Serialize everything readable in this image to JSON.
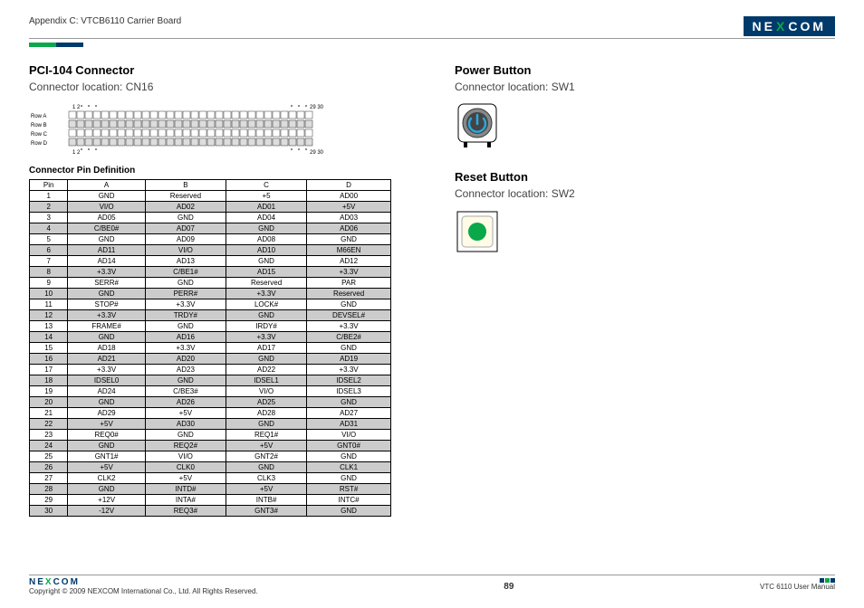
{
  "header": {
    "title": "Appendix C: VTCB6110 Carrier Board",
    "brand_parts": [
      "NE",
      "X",
      "COM"
    ]
  },
  "left": {
    "heading": "PCI-104 Connector",
    "sub": "Connector location: CN16",
    "diagram": {
      "row_labels": [
        "Row A",
        "Row B",
        "Row C",
        "Row D"
      ],
      "top_start": "1  2",
      "top_end": "29 30",
      "bot_start": "1  2",
      "bot_end": "29 30"
    },
    "table_caption": "Connector Pin Definition",
    "columns": [
      "Pin",
      "A",
      "B",
      "C",
      "D"
    ],
    "rows": [
      [
        "1",
        "GND",
        "Reserved",
        "+5",
        "AD00"
      ],
      [
        "2",
        "VI/O",
        "AD02",
        "AD01",
        "+5V"
      ],
      [
        "3",
        "AD05",
        "GND",
        "AD04",
        "AD03"
      ],
      [
        "4",
        "C/BE0#",
        "AD07",
        "GND",
        "AD06"
      ],
      [
        "5",
        "GND",
        "AD09",
        "AD08",
        "GND"
      ],
      [
        "6",
        "AD11",
        "VI/O",
        "AD10",
        "M66EN"
      ],
      [
        "7",
        "AD14",
        "AD13",
        "GND",
        "AD12"
      ],
      [
        "8",
        "+3.3V",
        "C/BE1#",
        "AD15",
        "+3.3V"
      ],
      [
        "9",
        "SERR#",
        "GND",
        "Reserved",
        "PAR"
      ],
      [
        "10",
        "GND",
        "PERR#",
        "+3.3V",
        "Reserved"
      ],
      [
        "11",
        "STOP#",
        "+3.3V",
        "LOCK#",
        "GND"
      ],
      [
        "12",
        "+3.3V",
        "TRDY#",
        "GND",
        "DEVSEL#"
      ],
      [
        "13",
        "FRAME#",
        "GND",
        "IRDY#",
        "+3.3V"
      ],
      [
        "14",
        "GND",
        "AD16",
        "+3.3V",
        "C/BE2#"
      ],
      [
        "15",
        "AD18",
        "+3.3V",
        "AD17",
        "GND"
      ],
      [
        "16",
        "AD21",
        "AD20",
        "GND",
        "AD19"
      ],
      [
        "17",
        "+3.3V",
        "AD23",
        "AD22",
        "+3.3V"
      ],
      [
        "18",
        "IDSEL0",
        "GND",
        "IDSEL1",
        "IDSEL2"
      ],
      [
        "19",
        "AD24",
        "C/BE3#",
        "VI/O",
        "IDSEL3"
      ],
      [
        "20",
        "GND",
        "AD26",
        "AD25",
        "GND"
      ],
      [
        "21",
        "AD29",
        "+5V",
        "AD28",
        "AD27"
      ],
      [
        "22",
        "+5V",
        "AD30",
        "GND",
        "AD31"
      ],
      [
        "23",
        "REQ0#",
        "GND",
        "REQ1#",
        "VI/O"
      ],
      [
        "24",
        "GND",
        "REQ2#",
        "+5V",
        "GNT0#"
      ],
      [
        "25",
        "GNT1#",
        "VI/O",
        "GNT2#",
        "GND"
      ],
      [
        "26",
        "+5V",
        "CLK0",
        "GND",
        "CLK1"
      ],
      [
        "27",
        "CLK2",
        "+5V",
        "CLK3",
        "GND"
      ],
      [
        "28",
        "GND",
        "INTD#",
        "+5V",
        "RST#"
      ],
      [
        "29",
        "+12V",
        "INTA#",
        "INTB#",
        "INTC#"
      ],
      [
        "30",
        "-12V",
        "REQ3#",
        "GNT3#",
        "GND"
      ]
    ]
  },
  "right": {
    "power_heading": "Power Button",
    "power_sub": "Connector location: SW1",
    "reset_heading": "Reset Button",
    "reset_sub": "Connector location: SW2"
  },
  "footer": {
    "copyright": "Copyright © 2009 NEXCOM International Co., Ltd. All Rights Reserved.",
    "page": "89",
    "doc": "VTC 6110 User Manual",
    "brand_parts": [
      "NE",
      "X",
      "COM"
    ]
  }
}
